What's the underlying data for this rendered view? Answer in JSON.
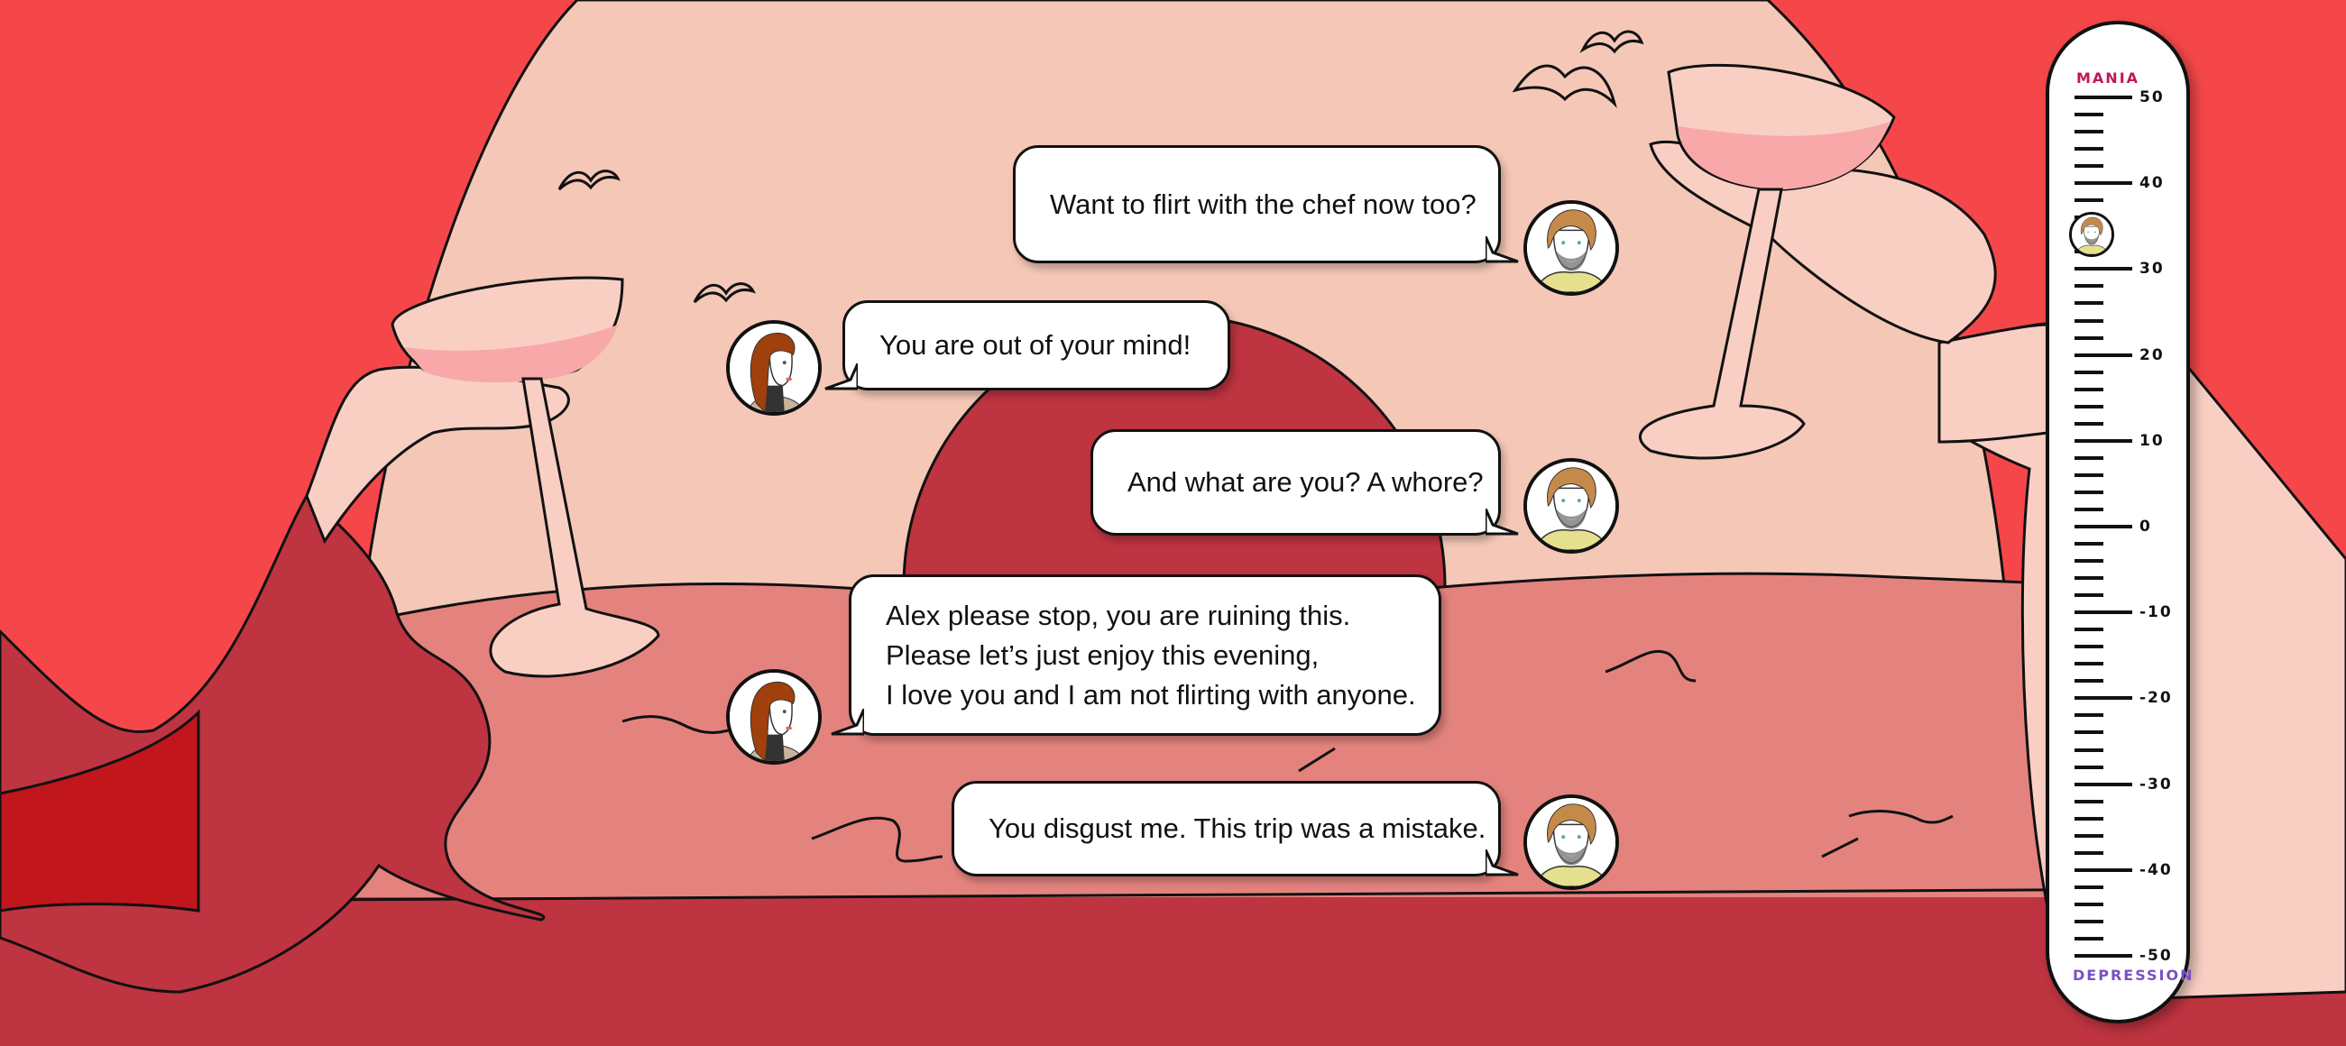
{
  "colors": {
    "background": "#F5474A",
    "sun": "#F4C7B7",
    "dark_sun": "#BE3440",
    "ground": "#E4837E",
    "table": "#BE3440",
    "skin": "#F9CFC4",
    "mania": "#C0175A",
    "depression": "#7C4FC4",
    "male_shirt": "#E4E08E",
    "female_hair": "#A0400C"
  },
  "messages": [
    {
      "speaker": "male",
      "avatar_icon": "male-avatar-icon",
      "lines": [
        "Want to flirt with the chef now too?"
      ]
    },
    {
      "speaker": "female",
      "avatar_icon": "female-avatar-icon",
      "lines": [
        "You are out of your mind!"
      ]
    },
    {
      "speaker": "male",
      "avatar_icon": "male-avatar-icon",
      "lines": [
        "And what are you? A whore?"
      ]
    },
    {
      "speaker": "female",
      "avatar_icon": "female-avatar-icon",
      "lines": [
        "Alex please stop, you are ruining this.",
        "Please let’s just enjoy this evening,",
        "I love you and I am not flirting with anyone."
      ]
    },
    {
      "speaker": "male",
      "avatar_icon": "male-avatar-icon",
      "lines": [
        "You disgust me. This trip was a mistake."
      ]
    }
  ],
  "mood_meter": {
    "top_label": "MANIA",
    "bottom_label": "DEPRESSION",
    "range": [
      -50,
      50
    ],
    "major_ticks": [
      "50",
      "40",
      "30",
      "20",
      "10",
      "0",
      "-10",
      "-20",
      "-30",
      "-40",
      "-50"
    ],
    "minor_step": 2,
    "marker_value": 34,
    "marker_icon": "male-avatar-icon"
  }
}
